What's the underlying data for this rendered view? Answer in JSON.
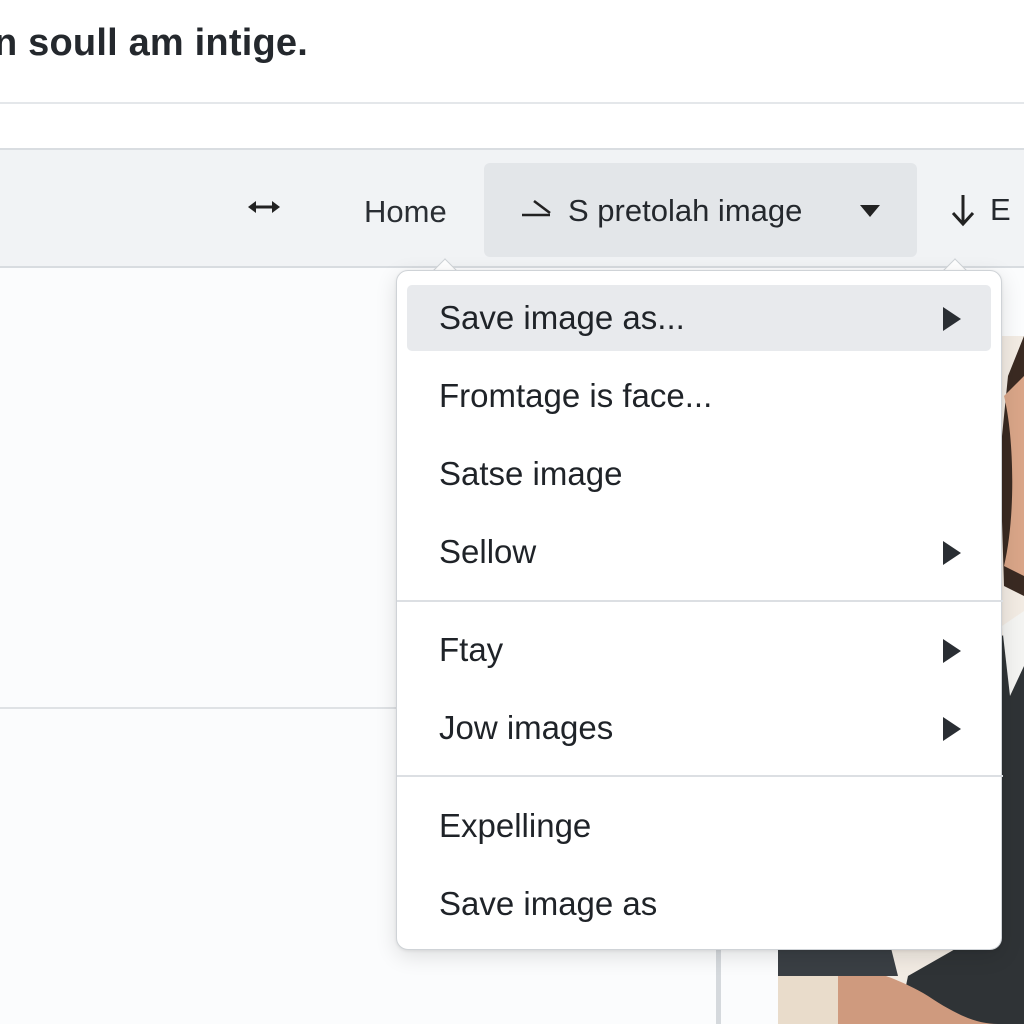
{
  "page": {
    "title": "n soull am intige."
  },
  "toolbar": {
    "resize_icon": "horizontal-resize-icon",
    "home_label": "Home",
    "image_dropdown_label": "S pretolah image",
    "image_dropdown_icon": "arrow-right-icon",
    "export_label": "E",
    "export_icon": "download-arrow-icon"
  },
  "context_menu": {
    "items": [
      {
        "label": "Save image as...",
        "submenu": true,
        "highlighted": true
      },
      {
        "label": "Fromtage is face...",
        "submenu": false
      },
      {
        "label": "Satse image",
        "submenu": false
      },
      {
        "label": "Sellow",
        "submenu": true
      },
      {
        "label": "Ftay",
        "submenu": true
      },
      {
        "label": "Jow images",
        "submenu": true
      },
      {
        "label": "Expellinge",
        "submenu": false
      },
      {
        "label": "Save image as",
        "submenu": false
      }
    ]
  },
  "colors": {
    "background": "#fbfcfd",
    "toolbar": "#f1f3f5",
    "dropdown_active": "#e3e6e9",
    "menu_highlight": "#e8eaed",
    "text": "#1f2328"
  }
}
